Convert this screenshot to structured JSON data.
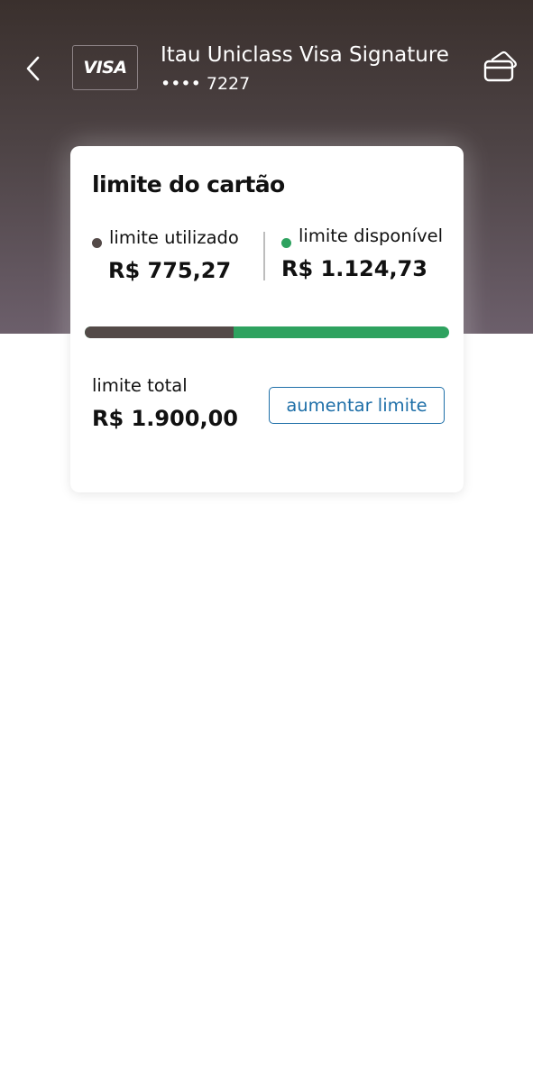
{
  "header": {
    "back_icon": "chevron-left-icon",
    "brand_logo": "VISA",
    "card_name": "Itau Uniclass Visa Signature",
    "card_number": "•••• 7227",
    "card_action_icon": "credit-card-icon"
  },
  "limit_card": {
    "title": "limite do cartão",
    "used": {
      "label": "limite utilizado",
      "value": "R$ 775,27",
      "color": "#544a48"
    },
    "available": {
      "label": "limite disponível",
      "value": "R$ 1.124,73",
      "color": "#2ea25f"
    },
    "usage_fraction": 0.408,
    "total": {
      "label": "limite total",
      "value": "R$ 1.900,00"
    },
    "increase_button_label": "aumentar limite"
  },
  "colors": {
    "header_top": "#3a302d",
    "header_bottom": "#6c5f6b",
    "accent_blue": "#1e6fa8"
  }
}
